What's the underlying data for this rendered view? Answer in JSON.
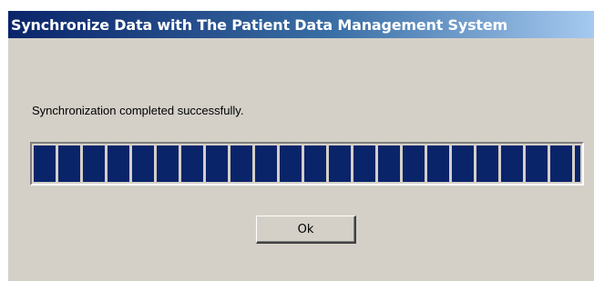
{
  "window": {
    "title": "Synchronize Data with The Patient Data Management System"
  },
  "message": "Synchronization completed successfully.",
  "progress": {
    "value_fraction": 1.0,
    "fill_color": "#0a246a"
  },
  "buttons": {
    "ok_label": "Ok"
  },
  "colors": {
    "dialog_background": "#d4d0c8",
    "title_gradient_start": "#0a246a",
    "title_gradient_end": "#a6caf0"
  }
}
